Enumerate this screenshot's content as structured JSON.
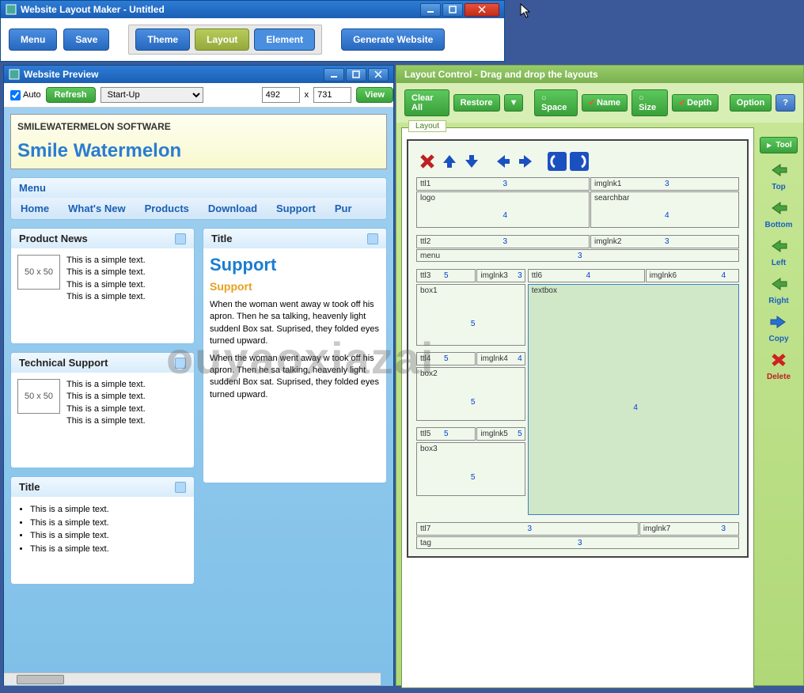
{
  "main_window": {
    "title": "Website Layout Maker - Untitled",
    "toolbar": {
      "menu": "Menu",
      "save": "Save",
      "theme": "Theme",
      "layout": "Layout",
      "element": "Element",
      "generate": "Generate Website"
    }
  },
  "preview_window": {
    "title": "Website Preview",
    "toolbar": {
      "auto": "Auto",
      "refresh": "Refresh",
      "dropdown": "Start-Up",
      "width": "492",
      "x": "x",
      "height": "731",
      "view": "View"
    },
    "site": {
      "tagline": "SMILEWATERMELON SOFTWARE",
      "logo": "Smile Watermelon",
      "menu_header": "Menu",
      "menu_items": [
        "Home",
        "What's New",
        "Products",
        "Download",
        "Support",
        "Pur"
      ],
      "panels": {
        "product_news": {
          "title": "Product News",
          "thumb": "50 x 50",
          "lines": [
            "This is a simple text.",
            "This is a simple text.",
            "This is a simple text.",
            "This is a simple text."
          ]
        },
        "title_panel": {
          "title": "Title",
          "h2": "Support",
          "h3": "Support",
          "para1": "When the woman went away w took off his apron. Then he sa talking, heavenly light suddenl Box sat. Suprised, they folded eyes turned upward.",
          "para2": "When the woman went away w took off his apron. Then he sa talking, heavenly light suddenl Box sat. Suprised, they folded eyes turned upward."
        },
        "technical_support": {
          "title": "Technical Support",
          "thumb": "50 x 50",
          "lines": [
            "This is a simple text.",
            "This is a simple text.",
            "This is a simple text.",
            "This is a simple text."
          ]
        },
        "title_bullets": {
          "title": "Title",
          "items": [
            "This is a simple text.",
            "This is a simple text.",
            "This is a simple text.",
            "This is a simple text."
          ]
        }
      }
    }
  },
  "layout_window": {
    "title": "Layout Control - Drag and drop the layouts",
    "toolbar": {
      "clear_all": "Clear All",
      "restore": "Restore",
      "space": "Space",
      "name": "Name",
      "size": "Size",
      "depth": "Depth",
      "option": "Option",
      "help": "?"
    },
    "tab": "Layout",
    "cells": {
      "ttl1": {
        "name": "ttl1",
        "num": "3"
      },
      "imglnk1": {
        "name": "imglnk1",
        "num": "3"
      },
      "logo": {
        "name": "logo",
        "num": "4"
      },
      "searchbar": {
        "name": "searchbar",
        "num": "4"
      },
      "ttl2": {
        "name": "ttl2",
        "num": "3"
      },
      "imglnk2": {
        "name": "imglnk2",
        "num": "3"
      },
      "menu": {
        "name": "menu",
        "num": "3"
      },
      "ttl3": {
        "name": "ttl3",
        "num": "5"
      },
      "imglnk3": {
        "name": "imglnk3",
        "num_cut": "3"
      },
      "ttl6": {
        "name": "ttl6",
        "num": "4"
      },
      "imglnk6": {
        "name": "imglnk6",
        "num": "4"
      },
      "box1": {
        "name": "box1",
        "num": "5"
      },
      "textbox": {
        "name": "textbox",
        "num": "4"
      },
      "ttl4": {
        "name": "ttl4",
        "num": "5"
      },
      "imglnk4": {
        "name": "imglnk4",
        "num_cut": "4"
      },
      "box2": {
        "name": "box2",
        "num": "5"
      },
      "ttl5": {
        "name": "ttl5",
        "num": "5"
      },
      "imglnk5": {
        "name": "imglnk5",
        "num_cut": "5"
      },
      "box3": {
        "name": "box3",
        "num": "5"
      },
      "ttl7": {
        "name": "ttl7",
        "num": "3"
      },
      "imglnk7": {
        "name": "imglnk7",
        "num": "3"
      },
      "tag": {
        "name": "tag",
        "num": "3"
      }
    },
    "side": {
      "tool": "Tool",
      "top": "Top",
      "bottom": "Bottom",
      "left": "Left",
      "right": "Right",
      "copy": "Copy",
      "delete": "Delete"
    }
  },
  "watermark": "ouyaoxiazai"
}
